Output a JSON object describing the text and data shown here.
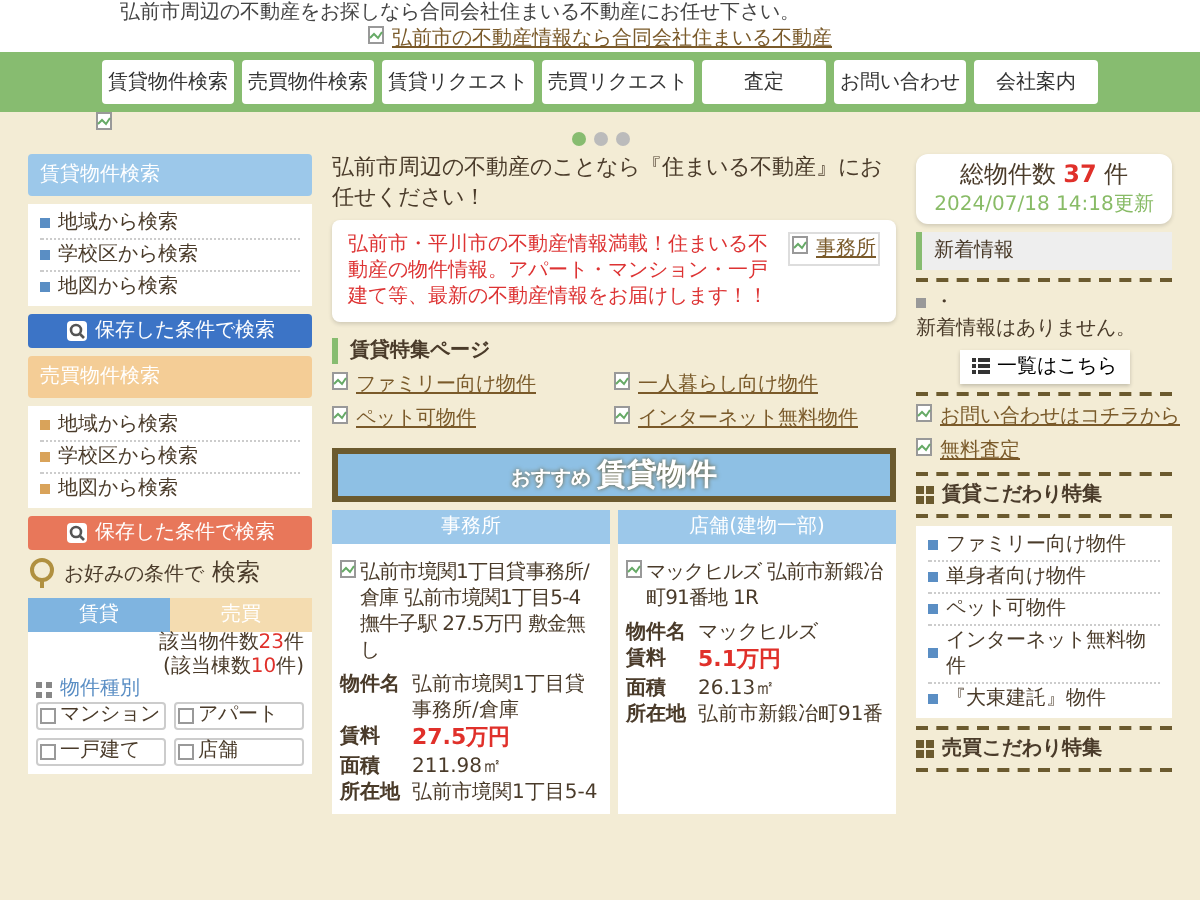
{
  "header": {
    "tagline": "弘前市周辺の不動産をお探しなら合同会社住まいる不動産にお任せ下さい。",
    "logo_alt": "弘前市の不動産情報なら合同会社住まいる不動産"
  },
  "nav": [
    "賃貸物件検索",
    "売買物件検索",
    "賃貸リクエスト",
    "売買リクエスト",
    "査定",
    "お問い合わせ",
    "会社案内"
  ],
  "slider": {
    "dots": [
      {
        "selected": true
      },
      {
        "selected": false
      },
      {
        "selected": false
      }
    ]
  },
  "left": {
    "sections": [
      {
        "kind": "rent",
        "title": "賃貸物件検索",
        "items": [
          "地域から検索",
          "学校区から検索",
          "地図から検索"
        ],
        "button": "保存した条件で検索"
      },
      {
        "kind": "sale",
        "title": "売買物件検索",
        "items": [
          "地域から検索",
          "学校区から検索",
          "地図から検索"
        ],
        "button": "保存した条件で検索"
      }
    ],
    "search": {
      "title_lead": "お好みの条件で",
      "title_main": "検索",
      "tabs": [
        {
          "label": "賃貸",
          "selected": true
        },
        {
          "label": "売買",
          "selected": false
        }
      ],
      "hit": {
        "prefix": "該当物件数",
        "value": "23",
        "suffix": "件"
      },
      "building": {
        "prefix": "(該当棟数",
        "value": "10",
        "suffix": "件)"
      },
      "group_label": "物件種別",
      "options": [
        {
          "label": "マンション",
          "checked": false
        },
        {
          "label": "アパート",
          "checked": false
        },
        {
          "label": "一戸建て",
          "checked": false
        },
        {
          "label": "店舗",
          "checked": false
        }
      ]
    }
  },
  "center": {
    "intro": "弘前市周辺の不動産のことなら『住まいる不動産』にお任せください！",
    "message": "弘前市・平川市の不動産情報満載！住まいる不動産の物件情報。アパート・マンション・一戸建て等、最新の不動産情報をお届けします！！",
    "office_alt": "事務所",
    "feature_title": "賃貸特集ページ",
    "feature_links": [
      "ファミリー向け物件",
      "一人暮らし向け物件",
      "ペット可物件",
      "インターネット無料物件"
    ],
    "banner": {
      "lead": "おすすめ",
      "main": "賃貸物件"
    },
    "cards": [
      {
        "type": "事務所",
        "image_alt": "弘前市境関1丁目貸事務所/倉庫 弘前市境関1丁目5-4 撫牛子駅 27.5万円 敷金無し",
        "specs": [
          {
            "label": "物件名",
            "value": "弘前市境関1丁目貸事務所/倉庫",
            "kind": "text"
          },
          {
            "label": "賃料",
            "value": "27.5万円",
            "kind": "price"
          },
          {
            "label": "面積",
            "value": "211.98㎡",
            "kind": "text"
          },
          {
            "label": "所在地",
            "value": "弘前市境関1丁目5-4",
            "kind": "text"
          }
        ]
      },
      {
        "type": "店舗(建物一部)",
        "image_alt": "マックヒルズ 弘前市新鍛冶町91番地 1R",
        "specs": [
          {
            "label": "物件名",
            "value": "マックヒルズ",
            "kind": "text"
          },
          {
            "label": "賃料",
            "value": "5.1万円",
            "kind": "price"
          },
          {
            "label": "面積",
            "value": "26.13㎡",
            "kind": "text"
          },
          {
            "label": "所在地",
            "value": "弘前市新鍛冶町91番",
            "kind": "text"
          }
        ]
      }
    ]
  },
  "right": {
    "total": {
      "label": "総物件数",
      "value": "37",
      "unit": "件",
      "updated": "2024/07/18 14:18更新"
    },
    "news": {
      "title": "新着情報",
      "bullet": "・",
      "empty": "新着情報はありません。",
      "button": "一覧はこちら"
    },
    "banners": [
      "お問い合わせはコチラから",
      "無料査定"
    ],
    "rent_features": {
      "title": "賃貸こだわり特集",
      "items": [
        "ファミリー向け物件",
        "単身者向け物件",
        "ペット可物件",
        "インターネット無料物件",
        "『大東建託』物件"
      ]
    },
    "sale_features": {
      "title": "売買こだわり特集"
    }
  }
}
